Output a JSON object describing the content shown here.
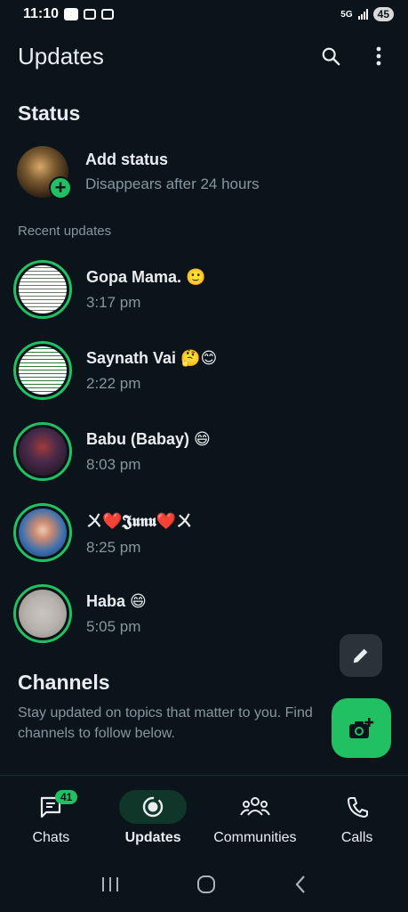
{
  "status_bar": {
    "time": "11:10",
    "network": "5G",
    "battery": "45"
  },
  "appbar": {
    "title": "Updates",
    "search_icon": "search-icon",
    "menu_icon": "more-vert-icon"
  },
  "status_section": {
    "title": "Status",
    "add_status": {
      "name": "Add status",
      "subtitle": "Disappears after 24 hours"
    },
    "recent_label": "Recent updates",
    "updates": [
      {
        "name": "Gopa Mama. 🙂",
        "time": "3:17 pm"
      },
      {
        "name": "Saynath Vai 🤔😊",
        "time": "2:22 pm"
      },
      {
        "name": "Babu (Babay) 😄",
        "time": "8:03 pm"
      },
      {
        "name": "ㄨ❤️𝕵𝖚𝖓𝖚❤️ㄨ",
        "time": "8:25 pm"
      },
      {
        "name": "Haba 😄",
        "time": "5:05 pm"
      }
    ]
  },
  "channels": {
    "title": "Channels",
    "description": "Stay updated on topics that matter to you. Find channels to follow below."
  },
  "bottom_nav": {
    "items": [
      {
        "label": "Chats",
        "badge": "41",
        "icon": "chat-icon"
      },
      {
        "label": "Updates",
        "icon": "status-icon",
        "active": true
      },
      {
        "label": "Communities",
        "icon": "communities-icon"
      },
      {
        "label": "Calls",
        "icon": "phone-icon"
      }
    ]
  },
  "colors": {
    "background": "#0b141a",
    "accent": "#21c063",
    "secondary_text": "#8696a0"
  }
}
